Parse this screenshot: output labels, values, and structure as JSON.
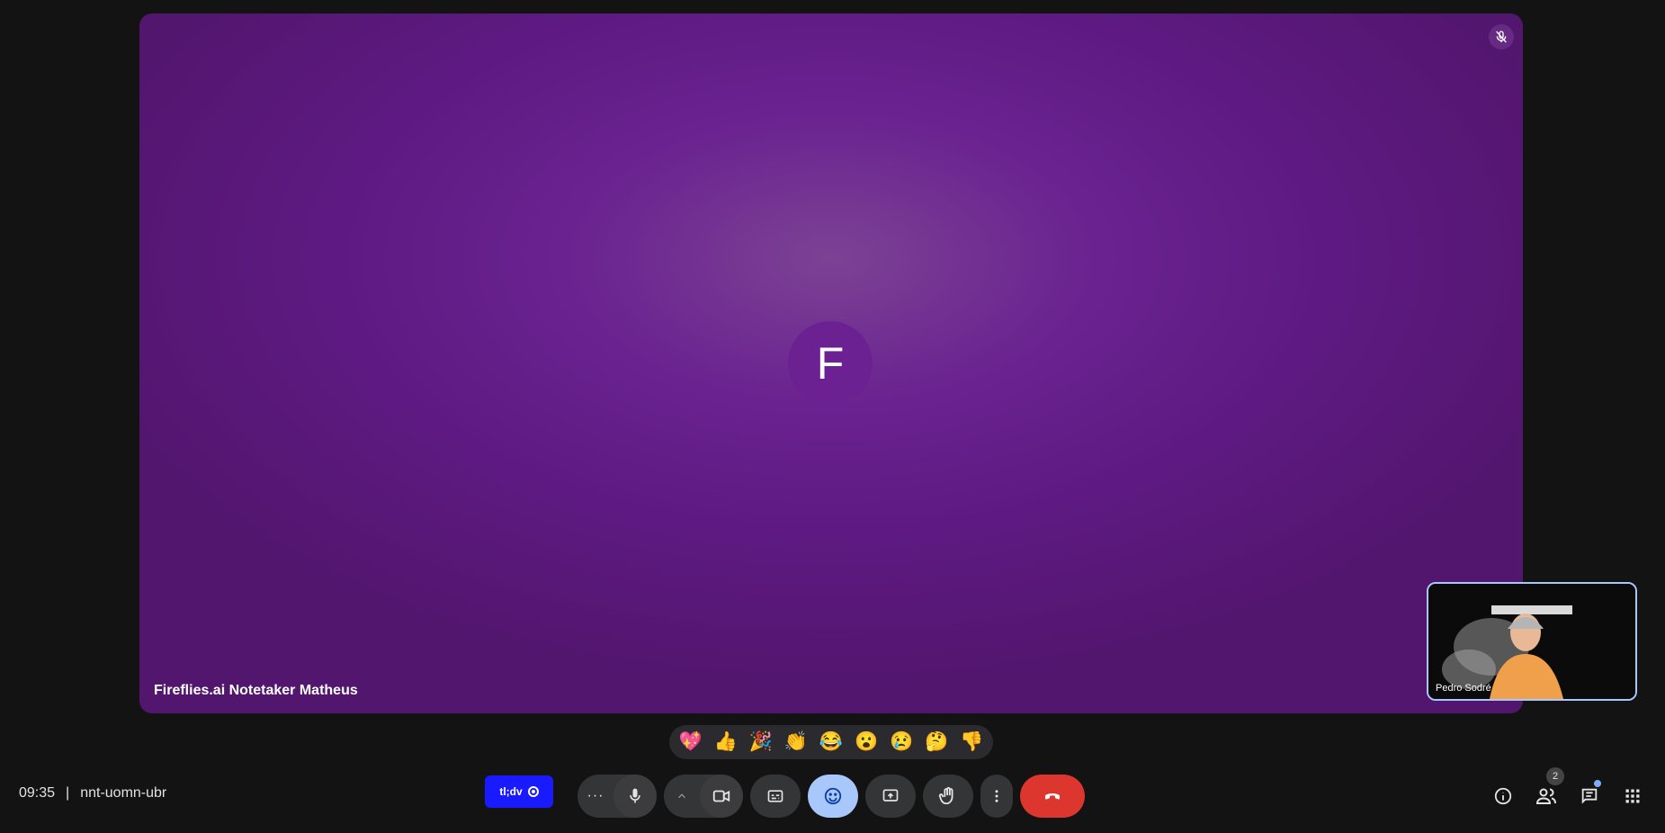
{
  "main_tile": {
    "avatar_letter": "F",
    "participant_name": "Fireflies.ai Notetaker Matheus",
    "muted": true
  },
  "self_view": {
    "participant_name": "Pedro Sodré"
  },
  "reactions": [
    "💖",
    "👍",
    "🎉",
    "👏",
    "😂",
    "😮",
    "😢",
    "🤔",
    "👎"
  ],
  "meeting": {
    "time": "09:35",
    "code": "nnt-uomn-ubr"
  },
  "extension": {
    "label": "tl;dv"
  },
  "controls": {
    "more_audio_label": "···",
    "mic": "microphone-icon",
    "camera": "camera-icon",
    "captions": "captions-icon",
    "emoji": "emoji-icon",
    "present": "present-icon",
    "hand": "raise-hand-icon",
    "more": "more-options-icon",
    "end": "end-call-icon"
  },
  "right_controls": {
    "people_count": "2"
  },
  "colors": {
    "background": "#131314",
    "tile": "#6a2290",
    "end_call": "#dc362e",
    "active_button": "#a8c7fa",
    "tldv": "#1a1aff"
  }
}
